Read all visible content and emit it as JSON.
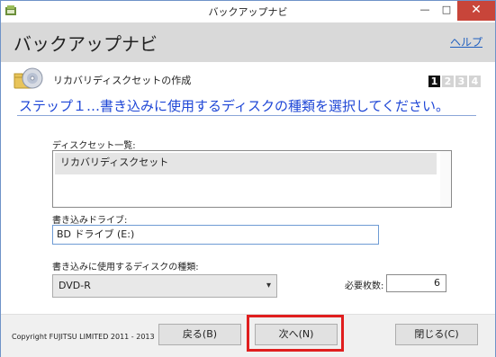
{
  "window": {
    "title": "バックアップナビ",
    "controls": {
      "minimize": "—",
      "maximize": "□",
      "close": "✕"
    }
  },
  "header": {
    "app_title": "バックアップナビ",
    "help_link": "ヘルプ"
  },
  "section": {
    "name": "リカバリディスクセットの作成",
    "steps": [
      "1",
      "2",
      "3",
      "4"
    ],
    "active_step": "1",
    "heading": "ステップ１…書き込みに使用するディスクの種類を選択してください。"
  },
  "form": {
    "disc_set_label": "ディスクセット一覧:",
    "disc_set_items": [
      "リカバリディスクセット"
    ],
    "drive_label": "書き込みドライブ:",
    "drive_value": "BD ドライブ (E:)",
    "disc_type_label": "書き込みに使用するディスクの種類:",
    "disc_type_value": "DVD-R",
    "count_label": "必要枚数:",
    "count_value": "6"
  },
  "footer": {
    "copyright": "Copyright FUJITSU LIMITED 2011 - 2013",
    "back_label": "戻る(B)",
    "next_label": "次へ(N)",
    "close_label": "閉じる(C)"
  },
  "colors": {
    "accent_blue": "#1e46d6",
    "highlight_red": "#e01e1e",
    "close_button": "#c8453a"
  },
  "icons": {
    "app": "backup-app-icon",
    "section": "disc-folder-icon"
  }
}
